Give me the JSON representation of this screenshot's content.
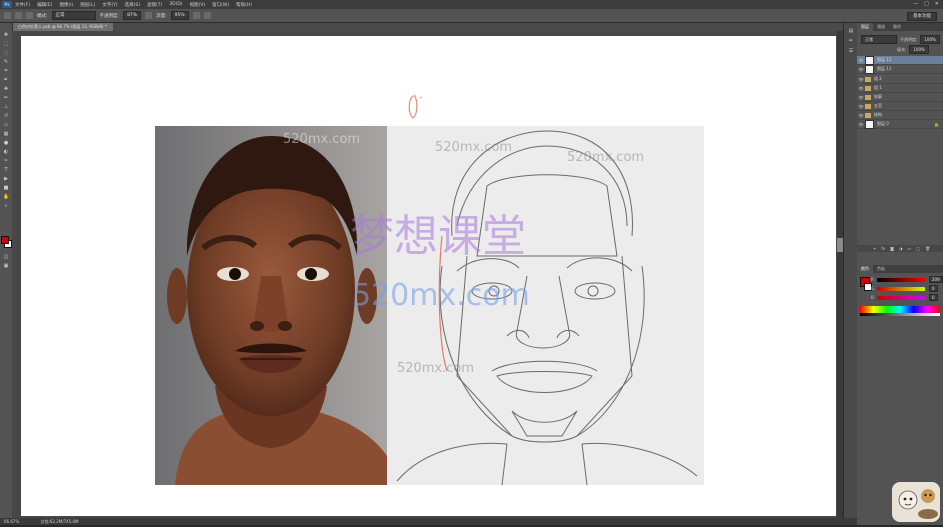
{
  "app": {
    "logo": "Ps",
    "menu": [
      "文件(F)",
      "编辑(E)",
      "图像(I)",
      "图层(L)",
      "文字(Y)",
      "选择(S)",
      "滤镜(T)",
      "3D(D)",
      "视图(V)",
      "窗口(W)",
      "帮助(H)"
    ],
    "window_controls": [
      "—",
      "□",
      "✕"
    ]
  },
  "options_bar": {
    "mode_label": "模式:",
    "mode_value": "正常",
    "opacity_label": "不透明度:",
    "opacity_value": "87%",
    "flow_label": "流量:",
    "flow_value": "95%",
    "workspace": "基本功能"
  },
  "document": {
    "tab_title": "白色衬衫黑人.psb @ 66.7% (图层 12, RGB/8) *",
    "status_zoom": "66.67%",
    "status_doc": "文档:62.2M/745.0M"
  },
  "watermark": {
    "title": "梦想课堂",
    "site": "520mx.com"
  },
  "layers_panel": {
    "tabs": [
      "图层",
      "通道",
      "路径"
    ],
    "blend_mode": "正常",
    "opacity_label": "不透明度:",
    "opacity_value": "100%",
    "fill_label": "填充:",
    "fill_value": "100%",
    "layers": [
      {
        "name": "图层 12",
        "type": "layer",
        "selected": true
      },
      {
        "name": "图层 11",
        "type": "layer",
        "selected": false
      },
      {
        "name": "组 2",
        "type": "group",
        "selected": false
      },
      {
        "name": "组 1",
        "type": "group",
        "selected": false
      },
      {
        "name": "轮廓",
        "type": "group",
        "selected": false
      },
      {
        "name": "五官",
        "type": "group",
        "selected": false
      },
      {
        "name": "结构",
        "type": "group",
        "selected": false
      },
      {
        "name": "图层 0",
        "type": "layer",
        "selected": false
      }
    ]
  },
  "color_panel": {
    "tabs": [
      "颜色",
      "色板"
    ],
    "channels": [
      {
        "label": "R",
        "value": "209"
      },
      {
        "label": "G",
        "value": "0"
      },
      {
        "label": "B",
        "value": "0"
      }
    ]
  },
  "colors": {
    "foreground": "#d10000",
    "background": "#ffffff",
    "layer_selected": "#6a7f9a"
  }
}
